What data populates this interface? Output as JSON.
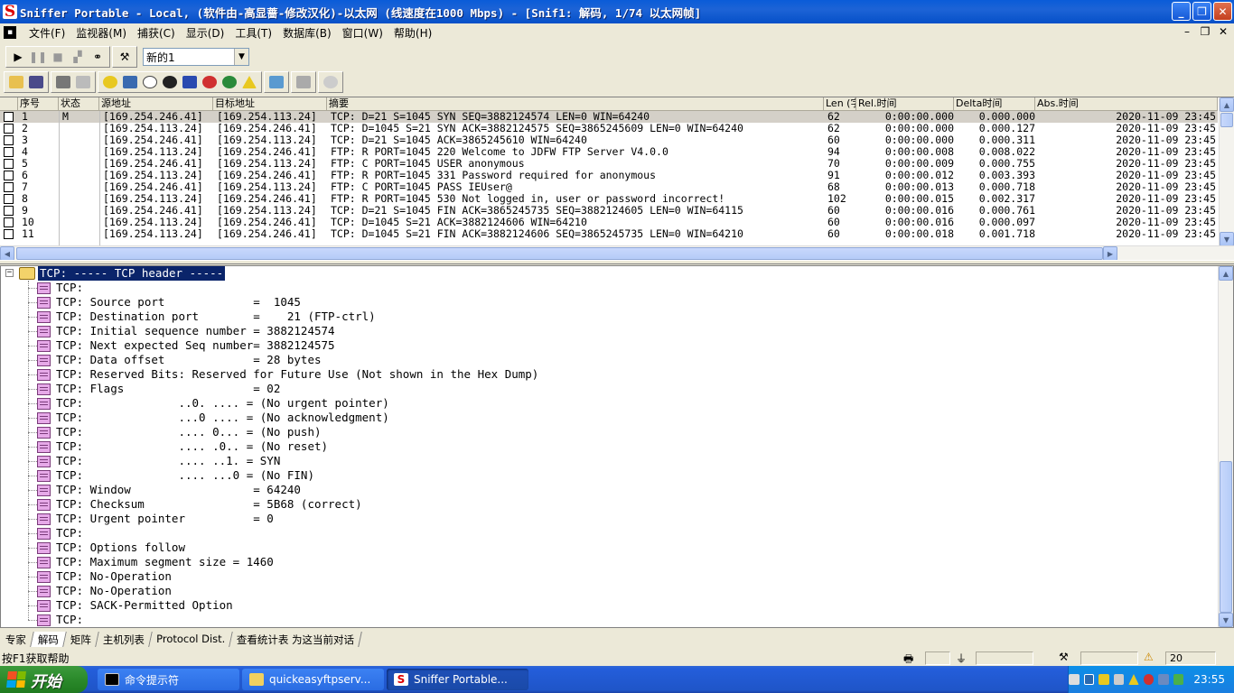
{
  "window": {
    "title": "Sniffer Portable - Local, (软件由-高显蔷-修改汉化)-以太网 (线速度在1000 Mbps) - [Snif1: 解码, 1/74 以太网帧]",
    "controls": [
      "_",
      "❐",
      "✕"
    ]
  },
  "menu": [
    "文件(F)",
    "监视器(M)",
    "捕获(C)",
    "显示(D)",
    "工具(T)",
    "数据库(B)",
    "窗口(W)",
    "帮助(H)"
  ],
  "toolbar": {
    "filter_profile": "新的1"
  },
  "columns": [
    "序号",
    "状态",
    "源地址",
    "目标地址",
    "摘要",
    "Len (字",
    "Rel.时间",
    "Delta时间",
    "Abs.时间"
  ],
  "packets": [
    [
      "1",
      "M",
      "[169.254.246.41]",
      "[169.254.113.24]",
      "TCP: D=21 S=1045 SYN SEQ=3882124574 LEN=0 WIN=64240",
      "62",
      "0:00:00.000",
      "0.000.000",
      "2020-11-09 23:45"
    ],
    [
      "2",
      "",
      "[169.254.113.24]",
      "[169.254.246.41]",
      "TCP: D=1045 S=21 SYN ACK=3882124575 SEQ=3865245609 LEN=0 WIN=64240",
      "62",
      "0:00:00.000",
      "0.000.127",
      "2020-11-09 23:45"
    ],
    [
      "3",
      "",
      "[169.254.246.41]",
      "[169.254.113.24]",
      "TCP: D=21 S=1045     ACK=3865245610 WIN=64240",
      "60",
      "0:00:00.000",
      "0.000.311",
      "2020-11-09 23:45"
    ],
    [
      "4",
      "",
      "[169.254.113.24]",
      "[169.254.246.41]",
      "FTP: R PORT=1045   220 Welcome to JDFW  FTP Server V4.0.0",
      "94",
      "0:00:00.008",
      "0.008.022",
      "2020-11-09 23:45"
    ],
    [
      "5",
      "",
      "[169.254.246.41]",
      "[169.254.113.24]",
      "FTP: C PORT=1045   USER anonymous",
      "70",
      "0:00:00.009",
      "0.000.755",
      "2020-11-09 23:45"
    ],
    [
      "6",
      "",
      "[169.254.113.24]",
      "[169.254.246.41]",
      "FTP: R PORT=1045   331 Password required for anonymous",
      "91",
      "0:00:00.012",
      "0.003.393",
      "2020-11-09 23:45"
    ],
    [
      "7",
      "",
      "[169.254.246.41]",
      "[169.254.113.24]",
      "FTP: C PORT=1045   PASS IEUser@",
      "68",
      "0:00:00.013",
      "0.000.718",
      "2020-11-09 23:45"
    ],
    [
      "8",
      "",
      "[169.254.113.24]",
      "[169.254.246.41]",
      "FTP: R PORT=1045   530 Not logged in, user or password incorrect!",
      "102",
      "0:00:00.015",
      "0.002.317",
      "2020-11-09 23:45"
    ],
    [
      "9",
      "",
      "[169.254.246.41]",
      "[169.254.113.24]",
      "TCP: D=21 S=1045 FIN ACK=3865245735 SEQ=3882124605 LEN=0 WIN=64115",
      "60",
      "0:00:00.016",
      "0.000.761",
      "2020-11-09 23:45"
    ],
    [
      "10",
      "",
      "[169.254.113.24]",
      "[169.254.246.41]",
      "TCP: D=1045 S=21     ACK=3882124606 WIN=64210",
      "60",
      "0:00:00.016",
      "0.000.097",
      "2020-11-09 23:45"
    ],
    [
      "11",
      "",
      "[169.254.113.24]",
      "[169.254.246.41]",
      "TCP: D=1045 S=21 FIN ACK=3882124606 SEQ=3865245735 LEN=0 WIN=64210",
      "60",
      "0:00:00.018",
      "0.001.718",
      "2020-11-09 23:45"
    ]
  ],
  "detail": {
    "header": "TCP: ----- TCP header -----",
    "lines": [
      "TCP:",
      "TCP: Source port             =  1045",
      "TCP: Destination port        =    21 (FTP-ctrl)",
      "TCP: Initial sequence number = 3882124574",
      "TCP: Next expected Seq number= 3882124575",
      "TCP: Data offset             = 28 bytes",
      "TCP: Reserved Bits: Reserved for Future Use (Not shown in the Hex Dump)",
      "TCP: Flags                   = 02",
      "TCP:              ..0. .... = (No urgent pointer)",
      "TCP:              ...0 .... = (No acknowledgment)",
      "TCP:              .... 0... = (No push)",
      "TCP:              .... .0.. = (No reset)",
      "TCP:              .... ..1. = SYN",
      "TCP:              .... ...0 = (No FIN)",
      "TCP: Window                  = 64240",
      "TCP: Checksum                = 5B68 (correct)",
      "TCP: Urgent pointer          = 0",
      "TCP:",
      "TCP: Options follow",
      "TCP: Maximum segment size = 1460",
      "TCP: No-Operation",
      "TCP: No-Operation",
      "TCP: SACK-Permitted Option",
      "TCP:"
    ]
  },
  "tabs": [
    "专家",
    "解码",
    "矩阵",
    "主机列表",
    "Protocol Dist.",
    "查看统计表 为这当前对话"
  ],
  "active_tab": "解码",
  "status": {
    "help_text": "按F1获取帮助",
    "count": "20"
  },
  "taskbar": {
    "start_label": "开始",
    "tasks": [
      "命令提示符",
      "quickeasyftpserv...",
      "Sniffer Portable..."
    ],
    "clock": "23:55"
  }
}
